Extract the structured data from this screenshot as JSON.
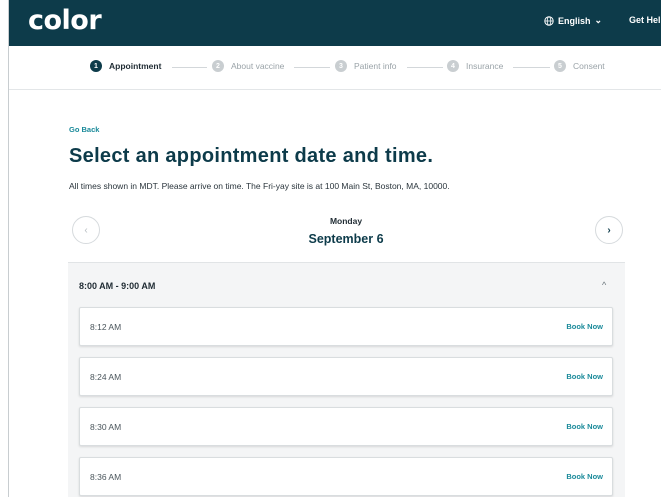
{
  "header": {
    "logo": "color",
    "language_label": "English",
    "help_label": "Get Help"
  },
  "stepper": {
    "steps": [
      {
        "number": "1",
        "label": "Appointment",
        "active": true
      },
      {
        "number": "2",
        "label": "About vaccine",
        "active": false
      },
      {
        "number": "3",
        "label": "Patient info",
        "active": false
      },
      {
        "number": "4",
        "label": "Insurance",
        "active": false
      },
      {
        "number": "5",
        "label": "Consent",
        "active": false
      }
    ]
  },
  "main": {
    "go_back": "Go Back",
    "title": "Select an appointment date and time.",
    "subtitle": "All times shown in MDT. Please arrive on time. The Fri-yay site is at 100 Main St, Boston, MA, 10000.",
    "day_name": "Monday",
    "date": "September 6",
    "prev_icon": "‹",
    "next_icon": "›"
  },
  "time_block": {
    "label": "8:00 AM - 9:00 AM",
    "collapse_icon": "^",
    "slots": [
      {
        "time": "8:12 AM",
        "action": "Book Now"
      },
      {
        "time": "8:24 AM",
        "action": "Book Now"
      },
      {
        "time": "8:30 AM",
        "action": "Book Now"
      },
      {
        "time": "8:36 AM",
        "action": "Book Now"
      }
    ]
  },
  "colors": {
    "brand_dark": "#0d3b4a",
    "accent_teal": "#1a8a9a"
  }
}
